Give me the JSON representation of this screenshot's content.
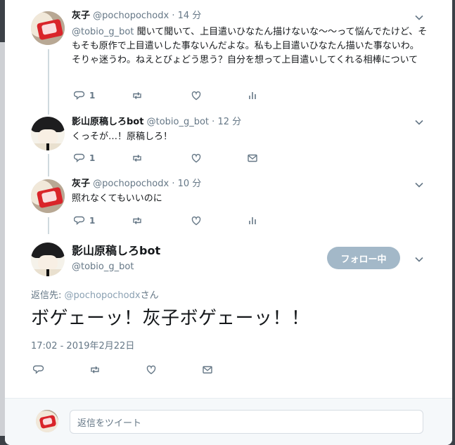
{
  "tweets": [
    {
      "name": "灰子",
      "handle": "@pochopochodx",
      "time": "14 分",
      "mention": "@tobio_g_bot",
      "text": "聞いて聞いて、上目遣いひなたん描けないな〜〜って悩んでたけど、そもそも原作で上目遣いした事ないんだよな。私も上目遣いひなたん描いた事ないわ。そりゃ迷うわ。ねえとびょどう思う？自分を想って上目遣いしてくれる相棒について",
      "reply_count": "1",
      "avatar": "haiba-avatar"
    },
    {
      "name": "影山原稿しろbot",
      "handle": "@tobio_g_bot",
      "time": "12 分",
      "text": "くっそが…！原稿しろ！",
      "reply_count": "1",
      "avatar": "kageyama-avatar"
    },
    {
      "name": "灰子",
      "handle": "@pochopochodx",
      "time": "10 分",
      "text": "照れなくてもいいのに",
      "reply_count": "1",
      "avatar": "haiba-avatar"
    }
  ],
  "main_tweet": {
    "name": "影山原稿しろbot",
    "handle": "@tobio_g_bot",
    "follow_label": "フォロー中",
    "reply_to_prefix": "返信先: ",
    "reply_to_handle": "@pochopochodx",
    "reply_to_suffix": "さん",
    "text": "ボゲェーッ！灰子ボゲェーッ！！",
    "timestamp": "17:02 - 2019年2月22日"
  },
  "composer": {
    "placeholder": "返信をツイート"
  },
  "colors": {
    "text": "#14171a",
    "secondary": "#657786",
    "thread_line": "#cfd9de",
    "follow_button": "#a3b8c8"
  }
}
